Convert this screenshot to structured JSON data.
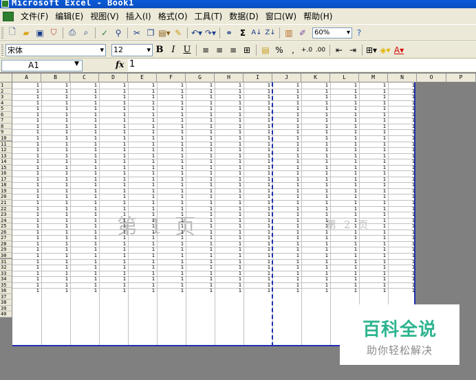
{
  "window": {
    "title": "Microsoft Excel - Book1"
  },
  "menu": {
    "items": [
      "文件(F)",
      "编辑(E)",
      "视图(V)",
      "插入(I)",
      "格式(O)",
      "工具(T)",
      "数据(D)",
      "窗口(W)",
      "帮助(H)"
    ]
  },
  "toolbar": {
    "zoom": "60%",
    "font_name": "宋体",
    "font_size": "12",
    "bold": "B",
    "italic": "I",
    "underline": "U",
    "percent": "%",
    "comma": ",",
    "sum": "Σ"
  },
  "formula_bar": {
    "cell_ref": "A1",
    "fx_label": "fx",
    "value": "1"
  },
  "sheet": {
    "columns": [
      "A",
      "B",
      "C",
      "D",
      "E",
      "F",
      "G",
      "H",
      "I",
      "J",
      "K",
      "L",
      "M",
      "N",
      "O",
      "P"
    ],
    "rows": [
      "1",
      "2",
      "3",
      "4",
      "5",
      "6",
      "7",
      "8",
      "9",
      "10",
      "11",
      "12",
      "13",
      "14",
      "15",
      "16",
      "17",
      "18",
      "19",
      "20",
      "21",
      "22",
      "23",
      "24",
      "25",
      "26",
      "27",
      "28",
      "29",
      "30",
      "31",
      "32",
      "33",
      "34",
      "35",
      "36",
      "37",
      "38",
      "39",
      "40"
    ],
    "cell_value": "1",
    "filled_columns": 14,
    "filled_rows": 36,
    "page_labels": [
      "第 1 页",
      "第 2 页"
    ]
  },
  "watermark": {
    "brand": "百科全说",
    "tagline": "助你轻松解决"
  }
}
